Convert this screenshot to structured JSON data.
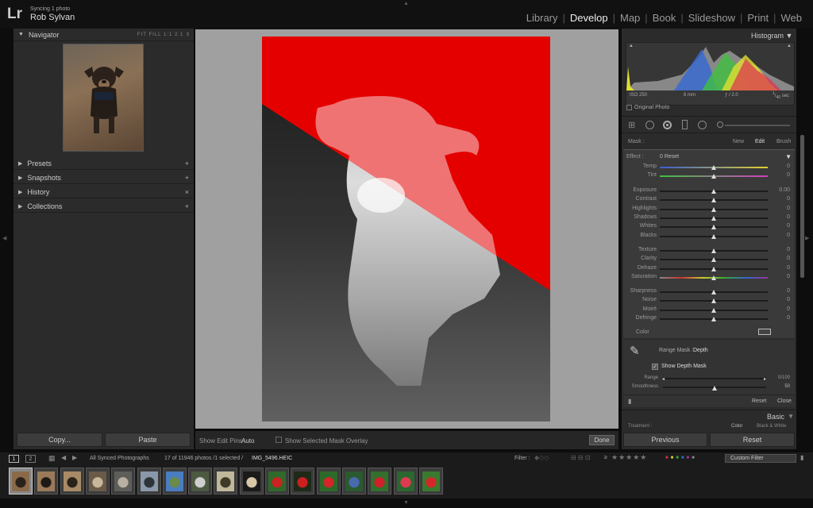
{
  "app": {
    "logo": "Lr",
    "sync_status": "Syncing 1 photo",
    "user_name": "Rob Sylvan"
  },
  "modules": [
    "Library",
    "Develop",
    "Map",
    "Book",
    "Slideshow",
    "Print",
    "Web"
  ],
  "active_module": "Develop",
  "left_panel": {
    "navigator": {
      "title": "Navigator",
      "zoom_options": [
        "FIT",
        "FILL",
        "1:1",
        "2:1"
      ]
    },
    "sections": [
      {
        "title": "Presets",
        "action": "+"
      },
      {
        "title": "Snapshots",
        "action": "+"
      },
      {
        "title": "History",
        "action": "×"
      },
      {
        "title": "Collections",
        "action": "+"
      }
    ],
    "copy_label": "Copy...",
    "paste_label": "Paste"
  },
  "toolbar": {
    "edit_pins_label": "Show Edit Pins :",
    "edit_pins_value": "Auto",
    "mask_overlay_label": "Show Selected Mask Overlay",
    "done_label": "Done"
  },
  "right_panel": {
    "histogram_title": "Histogram",
    "exif": {
      "iso": "ISO 250",
      "focal": "6 mm",
      "aperture": "ƒ / 2.0",
      "shutter_num": "1",
      "shutter_den": "40",
      "shutter_unit": "sec"
    },
    "original_photo_label": "Original Photo",
    "mask": {
      "label": "Mask :",
      "new": "New",
      "edit": "Edit",
      "brush": "Brush"
    },
    "effect": {
      "label": "Effect :",
      "value": "0 Reset"
    },
    "sliders_group1": [
      {
        "label": "Temp",
        "value": "0"
      },
      {
        "label": "Tint",
        "value": "0"
      }
    ],
    "sliders_group2": [
      {
        "label": "Exposure",
        "value": "0.00"
      },
      {
        "label": "Contrast",
        "value": "0"
      },
      {
        "label": "Highlights",
        "value": "0"
      },
      {
        "label": "Shadows",
        "value": "0"
      },
      {
        "label": "Whites",
        "value": "0"
      },
      {
        "label": "Blacks",
        "value": "0"
      }
    ],
    "sliders_group3": [
      {
        "label": "Texture",
        "value": "0"
      },
      {
        "label": "Clarity",
        "value": "0"
      },
      {
        "label": "Dehaze",
        "value": "0"
      },
      {
        "label": "Saturation",
        "value": "0"
      }
    ],
    "sliders_group4": [
      {
        "label": "Sharpness",
        "value": "0"
      },
      {
        "label": "Noise",
        "value": "0"
      },
      {
        "label": "Moiré",
        "value": "0"
      },
      {
        "label": "Defringe",
        "value": "0"
      }
    ],
    "color_label": "Color",
    "range_mask": {
      "label": "Range Mask :",
      "value": "Depth",
      "show_depth_label": "Show Depth Mask",
      "show_depth_checked": true,
      "range_label": "Range",
      "range_value": "0/100",
      "smoothness_label": "Smoothness",
      "smoothness_value": "50"
    },
    "reset_label": "Reset",
    "close_label": "Close",
    "basic_title": "Basic",
    "treatment_label": "Treatment :",
    "treatment_color": "Color",
    "treatment_bw": "Black & White",
    "previous_label": "Previous",
    "reset_bottom_label": "Reset"
  },
  "filmstrip_bar": {
    "page1": "1",
    "page2": "2",
    "source": "All Synced Photographs",
    "count": "17 of 11946 photos /1 selected /",
    "filename": "IMG_5496.HEIC",
    "filter_label": "Filter :",
    "rating_op": "≥",
    "custom_filter": "Custom Filter"
  },
  "thumbnails": [
    {
      "c1": "#8b6a4a",
      "c2": "#2a211c"
    },
    {
      "c1": "#9a7a5a",
      "c2": "#1f1a16"
    },
    {
      "c1": "#a88a66",
      "c2": "#2b2219"
    },
    {
      "c1": "#6a5a48",
      "c2": "#c9b79c"
    },
    {
      "c1": "#5d5d5a",
      "c2": "#b8b0a2"
    },
    {
      "c1": "#8a98aa",
      "c2": "#2e3338"
    },
    {
      "c1": "#4a7cc0",
      "c2": "#6a8a4a"
    },
    {
      "c1": "#4b5a40",
      "c2": "#cfcfcf"
    },
    {
      "c1": "#c0b89a",
      "c2": "#3d3a2a"
    },
    {
      "c1": "#1a1a1a",
      "c2": "#d8c8a8"
    },
    {
      "c1": "#2f6a2a",
      "c2": "#cc2222"
    },
    {
      "c1": "#1d2a18",
      "c2": "#cc2020"
    },
    {
      "c1": "#2c6a2a",
      "c2": "#d4262a"
    },
    {
      "c1": "#2a5a2f",
      "c2": "#4a6ab0"
    },
    {
      "c1": "#33702d",
      "c2": "#d0202a"
    },
    {
      "c1": "#2a6830",
      "c2": "#e03a50"
    },
    {
      "c1": "#3a7a30",
      "c2": "#d42828"
    }
  ]
}
